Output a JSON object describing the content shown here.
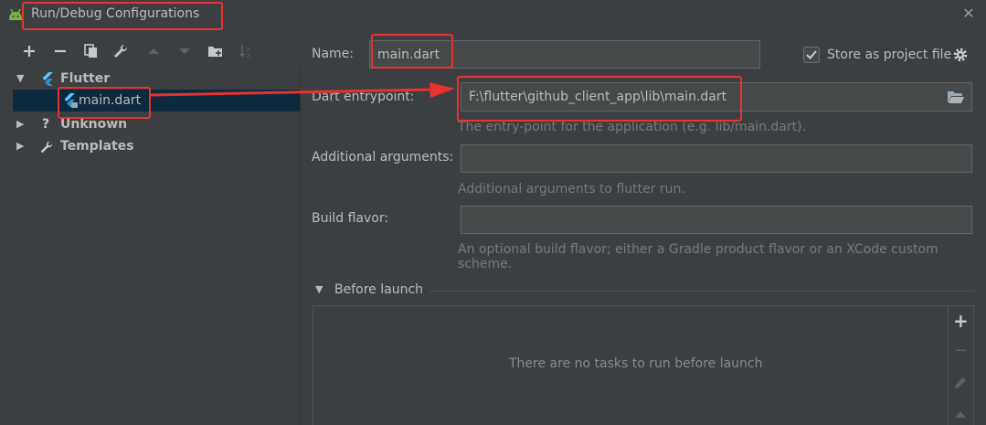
{
  "window": {
    "title": "Run/Debug Configurations",
    "close_glyph": "✕"
  },
  "toolbar": {
    "icons": [
      "add-icon",
      "remove-icon",
      "copy-icon",
      "wrench-icon",
      "move-up-icon",
      "move-down-icon",
      "folder-add-icon",
      "sort-icon"
    ]
  },
  "tree": {
    "items": [
      {
        "label": "Flutter",
        "icon": "flutter-icon",
        "expanded": true
      },
      {
        "label": "main.dart",
        "icon": "flutter-dart-icon",
        "selected": true
      },
      {
        "label": "Unknown",
        "icon": "question-icon",
        "expanded": false
      },
      {
        "label": "Templates",
        "icon": "wrench-icon",
        "expanded": false
      }
    ]
  },
  "form": {
    "name_label": "Name:",
    "name_value": "main.dart",
    "store_label": "Store as project file",
    "store_checked": true,
    "entry_label": "Dart entrypoint:",
    "entry_value": "F:\\flutter\\github_client_app\\lib\\main.dart",
    "entry_hint": "The entry-point for the application (e.g. lib/main.dart).",
    "args_label": "Additional arguments:",
    "args_value": "",
    "args_hint": "Additional arguments to flutter run.",
    "flavor_label": "Build flavor:",
    "flavor_value": "",
    "flavor_hint": "An optional build flavor; either a Gradle product flavor or an XCode custom scheme."
  },
  "before_launch": {
    "title": "Before launch",
    "empty_text": "There are no tasks to run before launch",
    "add_glyph": "+",
    "remove_glyph": "−"
  },
  "colors": {
    "accent_red": "#e8322d",
    "selection": "#0d293e",
    "flutter_blue": "#5ac8fa"
  }
}
